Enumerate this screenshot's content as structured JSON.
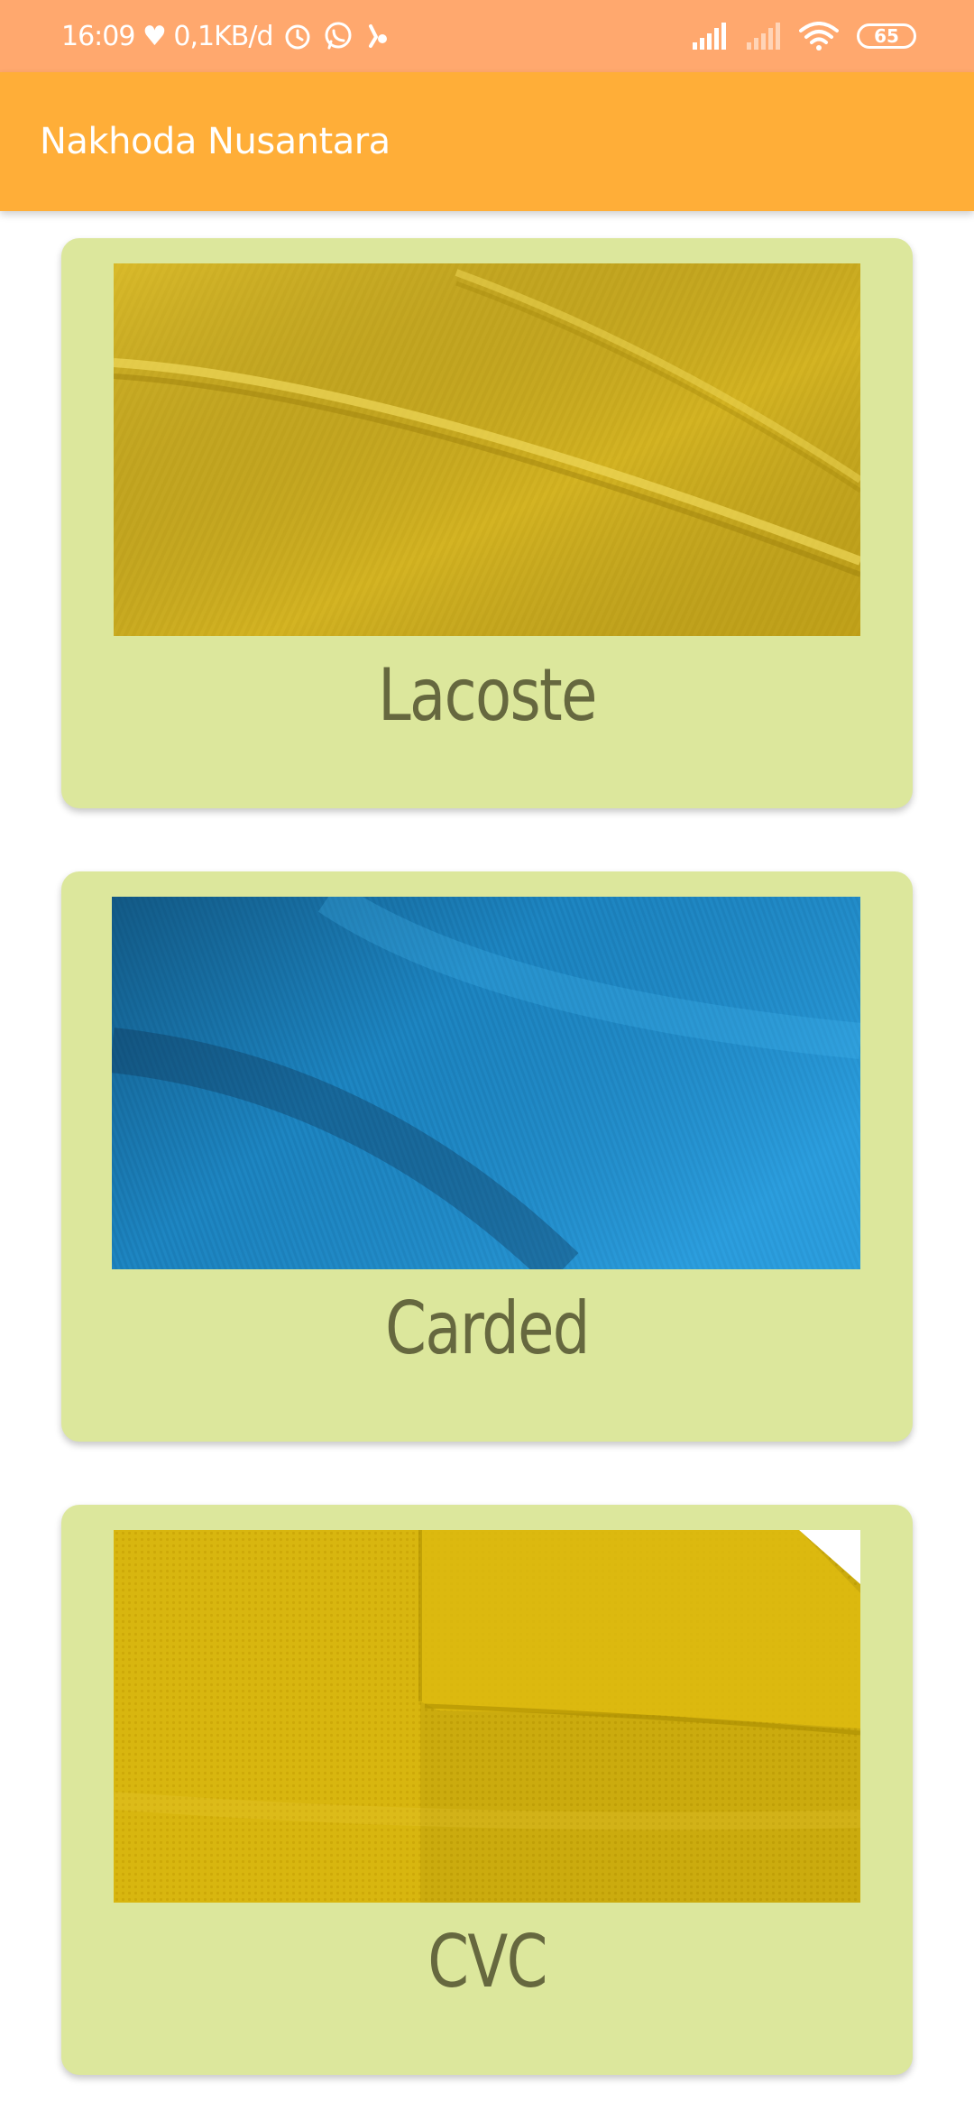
{
  "status_bar": {
    "time_and_speed": "16:09 ♥ 0,1KB/d",
    "battery": "65",
    "icons": [
      "heart-icon",
      "alarm-icon",
      "whatsapp-icon",
      "notification-icon",
      "signal-icon",
      "signal-weak-icon",
      "wifi-icon",
      "battery-icon"
    ]
  },
  "app_bar": {
    "title": "Nakhoda Nusantara"
  },
  "items": [
    {
      "label": "Lacoste",
      "image": "yellow-fabric-image",
      "color": "#d8b926"
    },
    {
      "label": "Carded",
      "image": "blue-fabric-image",
      "color": "#1f94d6"
    },
    {
      "label": "CVC",
      "image": "yellow-fabric-folded-image",
      "color": "#d8b60f"
    }
  ],
  "colors": {
    "status_bar": "#ffa86e",
    "app_bar": "#ffae38",
    "card": "#dce79c",
    "label": "#66683f"
  }
}
